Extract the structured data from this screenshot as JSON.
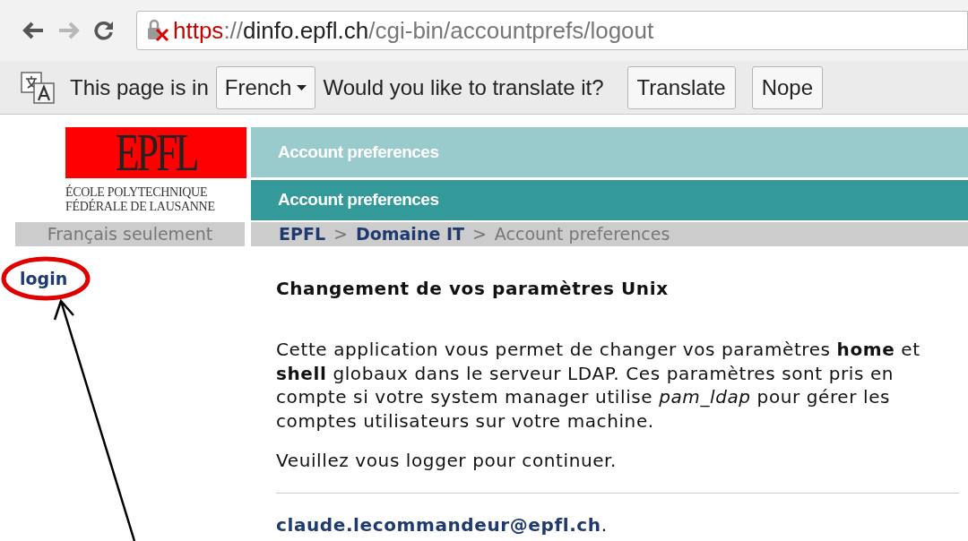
{
  "browser": {
    "back_disabled": false,
    "forward_disabled": true,
    "url": {
      "scheme": "https",
      "separator": "://",
      "host": "dinfo.epfl.ch",
      "path": "/cgi-bin/accountprefs/logout"
    }
  },
  "translate_bar": {
    "prefix": "This page is in",
    "language": "French",
    "question": "Would you like to translate it?",
    "buttons": [
      "Translate",
      "Nope"
    ]
  },
  "header": {
    "logo": {
      "mark": "EPFL",
      "line_1": "ÉCOLE POLYTECHNIQUE",
      "line_2": "FÉDÉRALE DE LAUSANNE"
    },
    "site_title": "Account preferences",
    "page_title": "Account preferences",
    "language_note": "Français seulement"
  },
  "breadcrumb": [
    {
      "label": "EPFL",
      "link": true
    },
    {
      "separator": ">",
      "label": "Domaine IT",
      "link": true
    },
    {
      "separator": ">",
      "label": "Account preferences",
      "link": false
    }
  ],
  "sidebar": {
    "items": [
      {
        "label": "login",
        "highlighted": true
      }
    ]
  },
  "content": {
    "heading": "Changement de vos paramètres Unix",
    "paragraphs": [
      "Cette application vous permet de changer vos paramètres **home** et **shell** globaux dans le serveur LDAP. Ces paramètres sont pris en compte si votre system manager utilise *pam_ldap* pour gérer les comptes utilisateurs sur votre machine.",
      "Veuillez vous logger pour continuer."
    ],
    "contact": {
      "email": "claude.lecommandeur@epfl.ch",
      "suffix": "."
    }
  }
}
